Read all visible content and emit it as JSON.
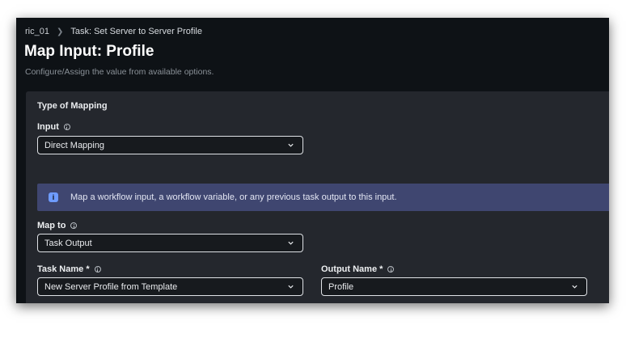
{
  "breadcrumb": {
    "parent": "ric_01",
    "current": "Task: Set Server to Server Profile"
  },
  "page": {
    "title": "Map Input: Profile",
    "subtitle": "Configure/Assign the value from available options."
  },
  "mapping": {
    "heading": "Type of Mapping",
    "input": {
      "label": "Input",
      "value": "Direct Mapping"
    },
    "banner": {
      "text": "Map a workflow input, a workflow variable, or any previous task output to this input."
    },
    "map_to": {
      "label": "Map to",
      "value": "Task Output"
    },
    "task_name": {
      "label": "Task Name *",
      "value": "New Server Profile from Template"
    },
    "output_name": {
      "label": "Output Name *",
      "value": "Profile"
    }
  },
  "icons": {
    "chevron": "chevron-down-icon",
    "breadcrumb_sep": "chevron-right-icon",
    "info": "info-icon",
    "banner": "info-filled-icon"
  },
  "colors": {
    "background": "#0e1216",
    "card": "#24272d",
    "banner": "#3f4670",
    "accent": "#6e9bff"
  }
}
